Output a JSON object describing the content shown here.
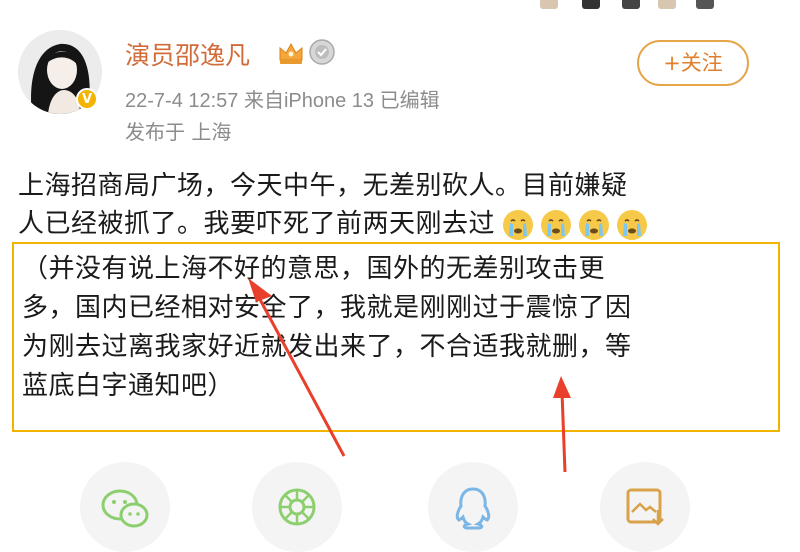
{
  "post": {
    "author": "演员邵逸凡",
    "meta": "22-7-4 12:57  来自iPhone 13  已编辑",
    "location": "发布于 上海",
    "follow_label": "+关注",
    "text_lines": [
      "上海招商局广场，今天中午，无差别砍人。目前嫌疑",
      "人已经被抓了。我要吓死了前两天刚去过"
    ],
    "boxed_lines": [
      "（并没有说上海不好的意思，国外的无差别攻击更",
      "多，国内已经相对安全了，我就是刚刚过于震惊了因",
      "为刚去过离我家好近就发出来了，不合适我就删，等",
      "蓝底白字通知吧）"
    ]
  },
  "icons": {
    "crying": "crying-face-emoji",
    "crown": "crown-icon",
    "medal": "medal-icon",
    "verified": "verified-v-badge"
  },
  "share_targets": [
    "wechat-icon",
    "moments-icon",
    "qq-icon",
    "save-image-icon"
  ],
  "colors": {
    "username": "#d16c3a",
    "follow_border": "#e5a64a",
    "highlight_border": "#f0b400",
    "arrows": "#e8402a",
    "share_green": "#8ccf6e",
    "share_blue": "#7ab6e6",
    "share_orange": "#d9a24a"
  }
}
